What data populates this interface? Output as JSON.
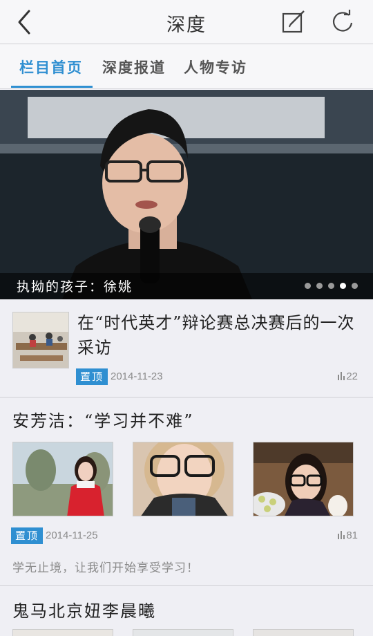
{
  "header": {
    "title": "深度"
  },
  "tabs": [
    {
      "label": "栏目首页",
      "active": true
    },
    {
      "label": "深度报道",
      "active": false
    },
    {
      "label": "人物专访",
      "active": false
    }
  ],
  "hero": {
    "caption": "执拗的孩子：徐姚",
    "slide_count": 5,
    "active_slide": 4
  },
  "articles": [
    {
      "title": "在“时代英才”辩论赛总决赛后的一次采访",
      "badge": "置顶",
      "date": "2014-11-23",
      "views": "22"
    },
    {
      "title": "安芳洁：“学习并不难”",
      "badge": "置顶",
      "date": "2014-11-25",
      "views": "81",
      "summary": "学无止境，让我们开始享受学习！"
    },
    {
      "title": "鬼马北京妞李晨曦"
    }
  ],
  "colors": {
    "accent": "#2f8fd1",
    "background": "#efeff4",
    "bar": "#f7f7f9"
  }
}
